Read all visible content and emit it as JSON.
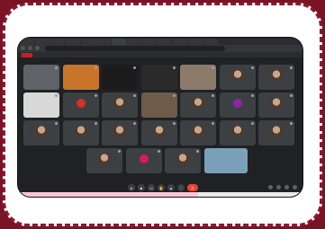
{
  "browser": {
    "tabs": [
      "",
      "",
      "",
      "",
      "",
      "",
      "",
      "",
      "",
      "",
      "",
      "",
      ""
    ],
    "url": "",
    "bookmark_red": ""
  },
  "participants": [
    {
      "name": "",
      "style": "gray"
    },
    {
      "name": "",
      "style": "orange-video"
    },
    {
      "name": "",
      "style": "dark-video"
    },
    {
      "name": "",
      "style": "dark-video2"
    },
    {
      "name": "",
      "style": "group-video"
    },
    {
      "name": "",
      "style": "photo-avatar"
    },
    {
      "name": "",
      "style": "photo-avatar2"
    },
    {
      "name": "",
      "style": "white-video"
    },
    {
      "name": "",
      "style": "red-avatar"
    },
    {
      "name": "",
      "style": "photo-avatar3"
    },
    {
      "name": "",
      "style": "person-video"
    },
    {
      "name": "",
      "style": "photo-avatar4"
    },
    {
      "name": "",
      "style": "purple-avatar"
    },
    {
      "name": "",
      "style": "photo-avatar5"
    },
    {
      "name": "",
      "style": "photo-avatar6"
    },
    {
      "name": "",
      "style": "photo-avatar7"
    },
    {
      "name": "",
      "style": "photo-avatar8"
    },
    {
      "name": "",
      "style": "photo-avatar9"
    },
    {
      "name": "",
      "style": "photo-avatar10"
    },
    {
      "name": "",
      "style": "photo-avatar11"
    },
    {
      "name": "",
      "style": "photo-avatar12"
    },
    {
      "name": "",
      "style": "photo-avatar13"
    },
    {
      "name": "",
      "style": "pink-avatar"
    },
    {
      "name": "",
      "style": "photo-avatar14"
    },
    {
      "name": "",
      "style": "outdoor-video"
    }
  ],
  "controls": {
    "time_meeting": "",
    "buttons": [
      "mic-icon",
      "camera-icon",
      "captions-icon",
      "hand-icon",
      "present-icon",
      "more-icon",
      "hangup-icon"
    ],
    "hangup_color": "#ea4335"
  },
  "colors": {
    "frame_bg": "#7a1326",
    "meet_bg": "#202124",
    "tile_bg": "#3c4043"
  }
}
